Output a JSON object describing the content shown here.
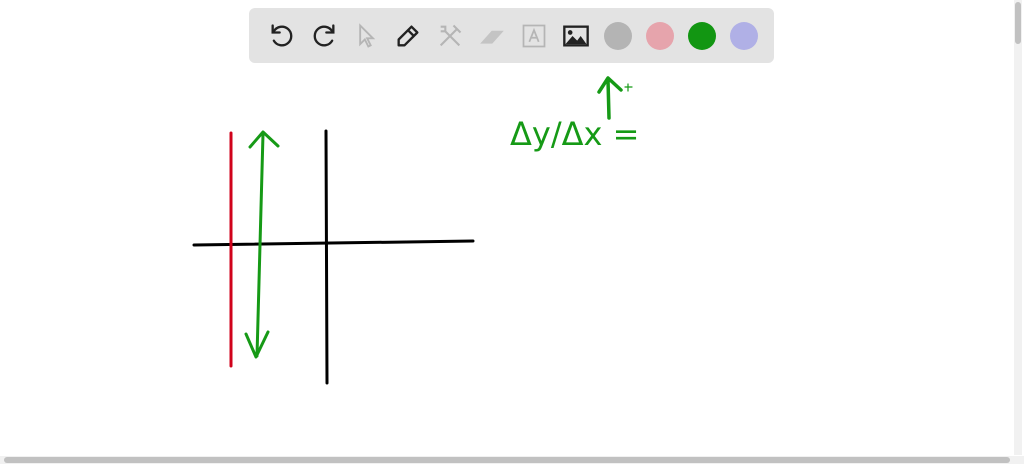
{
  "toolbar": {
    "tools": [
      {
        "name": "undo",
        "icon": "undo-icon",
        "enabled": true
      },
      {
        "name": "redo",
        "icon": "redo-icon",
        "enabled": true
      },
      {
        "name": "select",
        "icon": "cursor-icon",
        "enabled": false
      },
      {
        "name": "pen",
        "icon": "pencil-icon",
        "enabled": true
      },
      {
        "name": "tools",
        "icon": "tools-icon",
        "enabled": false
      },
      {
        "name": "eraser",
        "icon": "eraser-icon",
        "enabled": false
      },
      {
        "name": "text",
        "icon": "text-icon",
        "enabled": false
      },
      {
        "name": "image",
        "icon": "image-icon",
        "enabled": true
      }
    ],
    "colors": [
      "#b4b4b4",
      "#e6a4ac",
      "#129612",
      "#b0b0e6"
    ],
    "selected_color": "#129612"
  },
  "canvas": {
    "handwriting": "Δy/Δx =",
    "ink_colors": {
      "black": "#000000",
      "red": "#d0021b",
      "green": "#169a16"
    }
  }
}
